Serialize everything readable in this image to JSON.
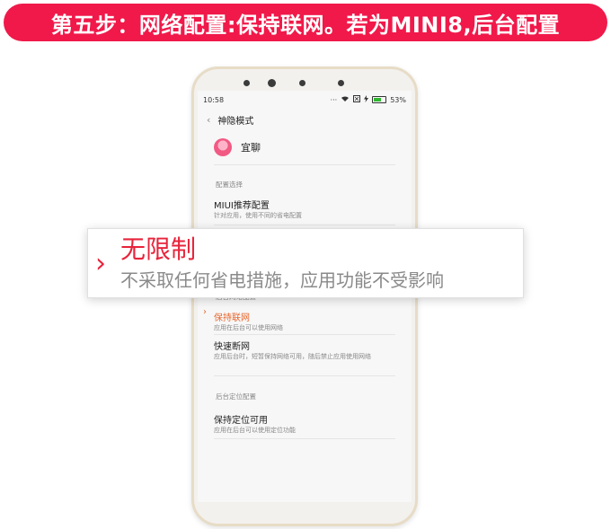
{
  "banner": {
    "text": "第五步：网络配置:保持联网。若为MINI8,后台配置"
  },
  "status_bar": {
    "time": "10:58",
    "battery_percent": "53%"
  },
  "page": {
    "back_glyph": "‹",
    "title": "神隐模式"
  },
  "app": {
    "name": "宜聊"
  },
  "sections": {
    "config": "配置选择",
    "network": "后台网络配置",
    "location": "后台定位配置"
  },
  "options": [
    {
      "title": "MIUI推荐配置",
      "desc": "针对应用，使用不同的省电配置"
    },
    {
      "title": "保持联网",
      "desc": "应用在后台可以使用网络",
      "selected": true
    },
    {
      "title": "快速断网",
      "desc": "应用后台时，短暂保持网络可用，随后禁止应用使用网络"
    },
    {
      "title": "保持定位可用",
      "desc": "应用在后台可以使用定位功能"
    }
  ],
  "popup": {
    "title": "无限制",
    "desc": "不采取任何省电措施，应用功能不受影响"
  },
  "colors": {
    "banner_bg": "#f0194a",
    "accent_red": "#e8233b",
    "selected_orange": "#e8662d",
    "phone_frame": "#e7dcc6"
  }
}
